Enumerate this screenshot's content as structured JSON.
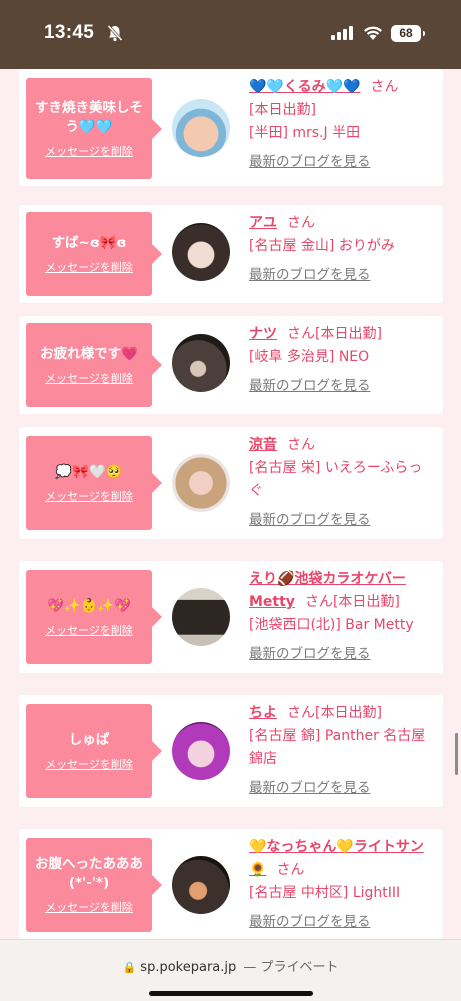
{
  "status": {
    "time": "13:45",
    "battery": "68"
  },
  "cards": [
    {
      "message": "すき焼き美味しそう🩵🩵",
      "delete": "メッセージを削除",
      "name": "💙🩵くるみ🩵💙",
      "san": "さん",
      "today": "",
      "shop": "[本日出勤]",
      "shop2": "[半田] mrs.J 半田",
      "blog": "最新のブログを見る"
    },
    {
      "message": "すば~ɞ🎀ɞ",
      "delete": "メッセージを削除",
      "name": "アユ",
      "san": "さん",
      "today": "",
      "shop": "[名古屋 金山] おりがみ",
      "shop2": "",
      "blog": "最新のブログを見る"
    },
    {
      "message": "お疲れ様です💗",
      "delete": "メッセージを削除",
      "name": "ナツ",
      "san": "さん",
      "today": "[本日出勤]",
      "shop": "[岐阜 多治見] NEO",
      "shop2": "",
      "blog": "最新のブログを見る"
    },
    {
      "message": "💭🎀🤍🥺",
      "delete": "メッセージを削除",
      "name": "涼音",
      "san": "さん",
      "today": "",
      "shop": "[名古屋 栄] いえろーふらっぐ",
      "shop2": "",
      "blog": "最新のブログを見る"
    },
    {
      "message": "💖✨👶✨💖",
      "delete": "メッセージを削除",
      "name": "えり🏈池袋カラオケバーMetty",
      "san": "さん",
      "today": "[本日出勤]",
      "shop": "[池袋西口(北)] Bar Metty",
      "shop2": "",
      "blog": "最新のブログを見る"
    },
    {
      "message": "しゅぱ",
      "delete": "メッセージを削除",
      "name": "ちよ",
      "san": "さん",
      "today": "[本日出勤]",
      "shop": "[名古屋 錦] Panther 名古屋錦店",
      "shop2": "",
      "blog": "最新のブログを見る"
    },
    {
      "message": "お腹へったあああ(*'-'*)",
      "delete": "メッセージを削除",
      "name": "💛なっちゃん💛ライトサン🌻",
      "san": "さん",
      "today": "",
      "shop": "[名古屋 中村区] LightIII",
      "shop2": "",
      "blog": "最新のブログを見る"
    }
  ],
  "browser": {
    "url": "sp.pokepara.jp",
    "private": "— プライベート"
  },
  "colors": {
    "accent": "#e8466a",
    "bubble": "#fa8a9c",
    "statusbar": "#5a4636"
  }
}
